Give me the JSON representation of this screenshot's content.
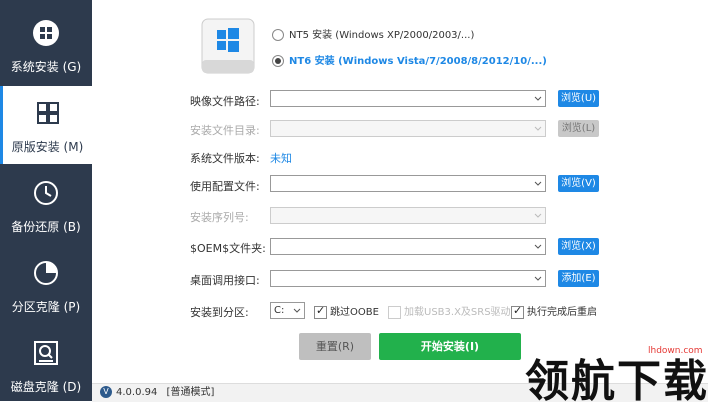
{
  "sidebar": {
    "items": [
      {
        "label": "系统安装 (G)",
        "icon": "windows-grid-icon",
        "active": false
      },
      {
        "label": "原版安装 (M)",
        "icon": "windows-logo-icon",
        "active": true
      },
      {
        "label": "备份还原 (B)",
        "icon": "clock-restore-icon",
        "active": false
      },
      {
        "label": "分区克隆 (P)",
        "icon": "pie-chart-icon",
        "active": false
      },
      {
        "label": "磁盘克隆 (D)",
        "icon": "disk-search-icon",
        "active": false
      }
    ]
  },
  "options": {
    "nt5": "NT5 安装 (Windows XP/2000/2003/...)",
    "nt6": "NT6 安装 (Windows Vista/7/2008/8/2012/10/...)"
  },
  "form": {
    "image_path_label": "映像文件路径:",
    "install_dir_label": "安装文件目录:",
    "version_label": "系统文件版本:",
    "version_value": "未知",
    "config_label": "使用配置文件:",
    "serial_label": "安装序列号:",
    "oem_label": "$OEM$文件夹:",
    "desktop_label": "桌面调用接口:",
    "partition_label": "安装到分区:",
    "partition_value": "C:"
  },
  "buttons": {
    "browse_u": "浏览(U)",
    "browse_l": "浏览(L)",
    "browse_v": "浏览(V)",
    "browse_x": "浏览(X)",
    "add_e": "添加(E)",
    "reset": "重置(R)",
    "start": "开始安装(I)"
  },
  "checkboxes": {
    "skip_oobe": "跳过OOBE",
    "load_driver": "加载USB3.X及SRS驱动",
    "restart": "执行完成后重启"
  },
  "status": {
    "version": "4.0.0.94",
    "mode": "[普通模式]"
  },
  "watermark": {
    "text": "领航下载",
    "url": "lhdown.com"
  },
  "colors": {
    "sidebar_bg": "#2d3a4d",
    "accent": "#1e88e5",
    "start_button": "#22b14c"
  }
}
